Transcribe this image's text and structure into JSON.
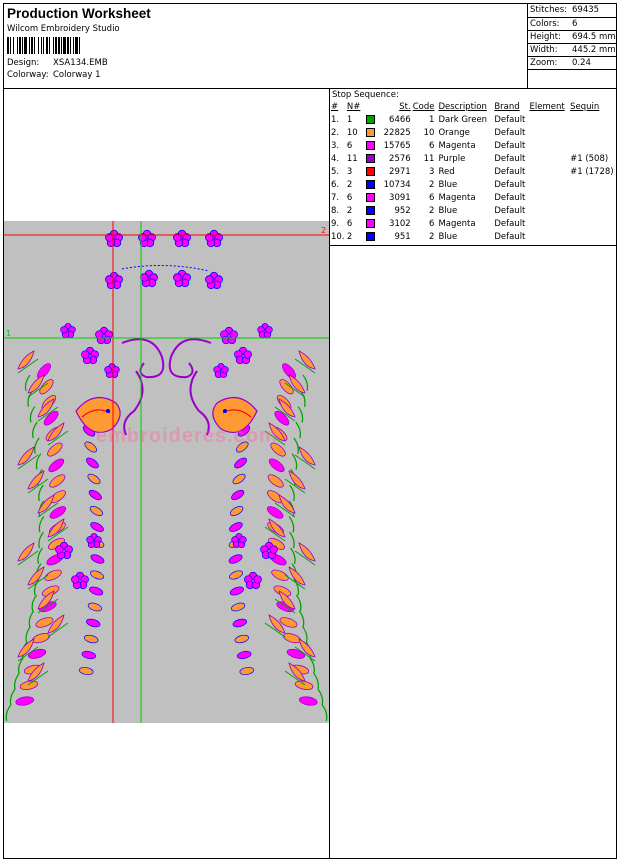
{
  "header": {
    "title": "Production Worksheet",
    "subtitle": "Wilcom Embroidery Studio",
    "design_label": "Design:",
    "design_value": "XSA134.EMB",
    "colorway_label": "Colorway:",
    "colorway_value": "Colorway 1"
  },
  "stats": {
    "stitches_label": "Stitches:",
    "stitches_value": "69435",
    "colors_label": "Colors:",
    "colors_value": "6",
    "height_label": "Height:",
    "height_value": "694.5 mm",
    "width_label": "Width:",
    "width_value": "445.2 mm",
    "zoom_label": "Zoom:",
    "zoom_value": "0.24"
  },
  "stop_sequence": {
    "title": "Stop Sequence:",
    "columns": [
      "#",
      "N#",
      "St.",
      "Code",
      "Description",
      "Brand",
      "Element",
      "Sequin"
    ],
    "rows": [
      {
        "idx": "1.",
        "n": "1",
        "color": "#00a000",
        "st": "6466",
        "code": "1",
        "desc": "Dark Green",
        "brand": "Default",
        "element": "",
        "sequin": ""
      },
      {
        "idx": "2.",
        "n": "10",
        "color": "#ff9933",
        "st": "22825",
        "code": "10",
        "desc": "Orange",
        "brand": "Default",
        "element": "",
        "sequin": ""
      },
      {
        "idx": "3.",
        "n": "6",
        "color": "#ff00ff",
        "st": "15765",
        "code": "6",
        "desc": "Magenta",
        "brand": "Default",
        "element": "",
        "sequin": ""
      },
      {
        "idx": "4.",
        "n": "11",
        "color": "#9900cc",
        "st": "2576",
        "code": "11",
        "desc": "Purple",
        "brand": "Default",
        "element": "",
        "sequin": "#1 (508)"
      },
      {
        "idx": "5.",
        "n": "3",
        "color": "#ff0000",
        "st": "2971",
        "code": "3",
        "desc": "Red",
        "brand": "Default",
        "element": "",
        "sequin": "#1 (1728)"
      },
      {
        "idx": "6.",
        "n": "2",
        "color": "#0000ff",
        "st": "10734",
        "code": "2",
        "desc": "Blue",
        "brand": "Default",
        "element": "",
        "sequin": ""
      },
      {
        "idx": "7.",
        "n": "6",
        "color": "#ff00ff",
        "st": "3091",
        "code": "6",
        "desc": "Magenta",
        "brand": "Default",
        "element": "",
        "sequin": ""
      },
      {
        "idx": "8.",
        "n": "2",
        "color": "#0000ff",
        "st": "952",
        "code": "2",
        "desc": "Blue",
        "brand": "Default",
        "element": "",
        "sequin": ""
      },
      {
        "idx": "9.",
        "n": "6",
        "color": "#ff00ff",
        "st": "3102",
        "code": "6",
        "desc": "Magenta",
        "brand": "Default",
        "element": "",
        "sequin": ""
      },
      {
        "idx": "10.",
        "n": "2",
        "color": "#0000ff",
        "st": "951",
        "code": "2",
        "desc": "Blue",
        "brand": "Default",
        "element": "",
        "sequin": ""
      }
    ]
  },
  "canvas": {
    "background": "#c0c0c0",
    "guide_red_label": "2",
    "guide_green_label": "1",
    "watermark": "embroideres.com"
  },
  "colors": {
    "guide_red": "#ff0000",
    "guide_green": "#00cc00",
    "magenta": "#ff00ff",
    "orange": "#ff9933",
    "green": "#00a000",
    "blue": "#0000ff",
    "purple": "#9900cc",
    "red": "#ff0000"
  }
}
